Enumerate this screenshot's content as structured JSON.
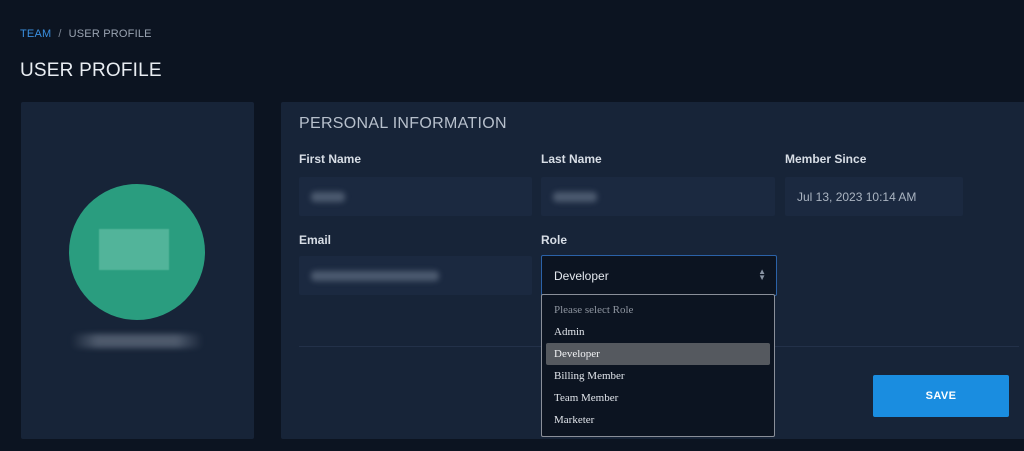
{
  "breadcrumb": {
    "link_label": "TEAM",
    "separator": "/",
    "current_label": "USER PROFILE"
  },
  "page": {
    "title": "USER PROFILE"
  },
  "avatar_card": {
    "avatar_color": "#2a9d7f",
    "name_blurred": true
  },
  "personal_info": {
    "section_title": "PERSONAL INFORMATION",
    "first_name": {
      "label": "First Name",
      "value_blurred": true
    },
    "last_name": {
      "label": "Last Name",
      "value_blurred": true
    },
    "member_since": {
      "label": "Member Since",
      "value": "Jul 13, 2023 10:14 AM"
    },
    "email": {
      "label": "Email",
      "value_blurred": true
    },
    "role": {
      "label": "Role",
      "selected": "Developer",
      "options": [
        {
          "label": "Please select Role",
          "placeholder": true
        },
        {
          "label": "Admin"
        },
        {
          "label": "Developer",
          "selected": true
        },
        {
          "label": "Billing Member"
        },
        {
          "label": "Team Member"
        },
        {
          "label": "Marketer"
        }
      ]
    },
    "save_label": "SAVE"
  },
  "colors": {
    "background": "#0c1421",
    "card": "#172438",
    "accent": "#1a8de0",
    "link": "#3a8fe0"
  }
}
